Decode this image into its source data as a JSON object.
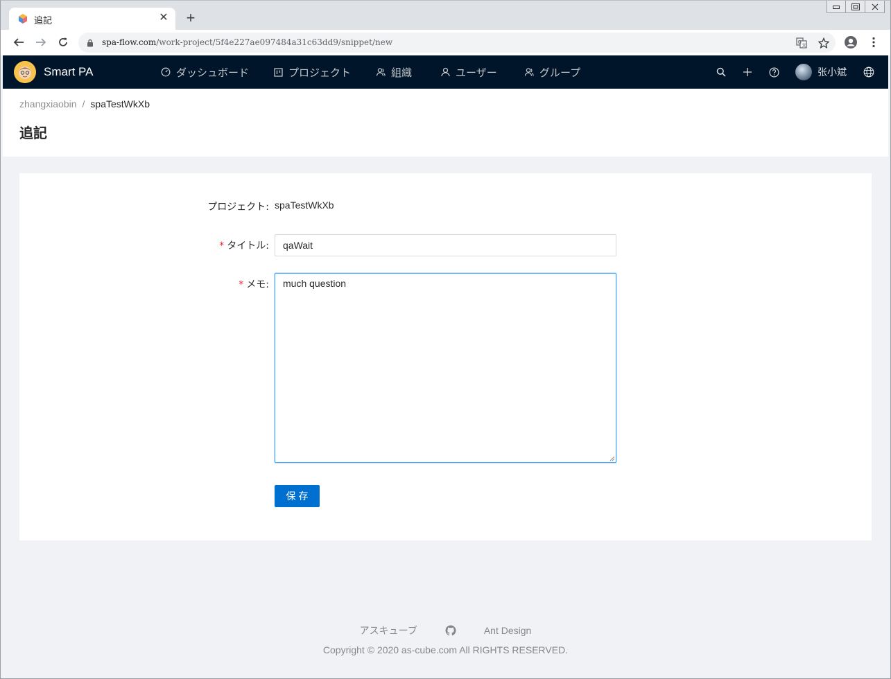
{
  "browser": {
    "tab_title": "追記",
    "url_host": "spa-flow.com",
    "url_path": "/work-project/5f4e227ae097484a31c63dd9/snippet/new",
    "icons": [
      "back-icon",
      "forward-icon",
      "reload-icon",
      "lock-icon",
      "translate-icon",
      "star-icon",
      "profile-icon",
      "menu-icon"
    ]
  },
  "header": {
    "app_name": "Smart PA",
    "menu": [
      {
        "label": "ダッシュボード",
        "icon": "dashboard-icon"
      },
      {
        "label": "プロジェクト",
        "icon": "project-icon"
      },
      {
        "label": "組織",
        "icon": "organization-icon"
      },
      {
        "label": "ユーザー",
        "icon": "user-icon"
      },
      {
        "label": "グループ",
        "icon": "group-icon"
      }
    ],
    "user_name": "张小斌",
    "bg_color": "#001529"
  },
  "breadcrumb": [
    "zhangxiaobin",
    "spaTestWkXb"
  ],
  "breadcrumb_separator": "/",
  "page_title": "追記",
  "form": {
    "project_label": "プロジェクト",
    "project_value": "spaTestWkXb",
    "title_label": "タイトル",
    "title_value": "qaWait",
    "memo_label": "メモ",
    "memo_value": "much question",
    "colon": ":",
    "required_mark": "*",
    "save_label": "保存",
    "primary_color": "#0070d0"
  },
  "footer": {
    "links": [
      "アスキューブ",
      "Ant Design"
    ],
    "github_icon": "github-icon",
    "copyright": "Copyright © 2020 as-cube.com All RIGHTS RESERVED."
  }
}
